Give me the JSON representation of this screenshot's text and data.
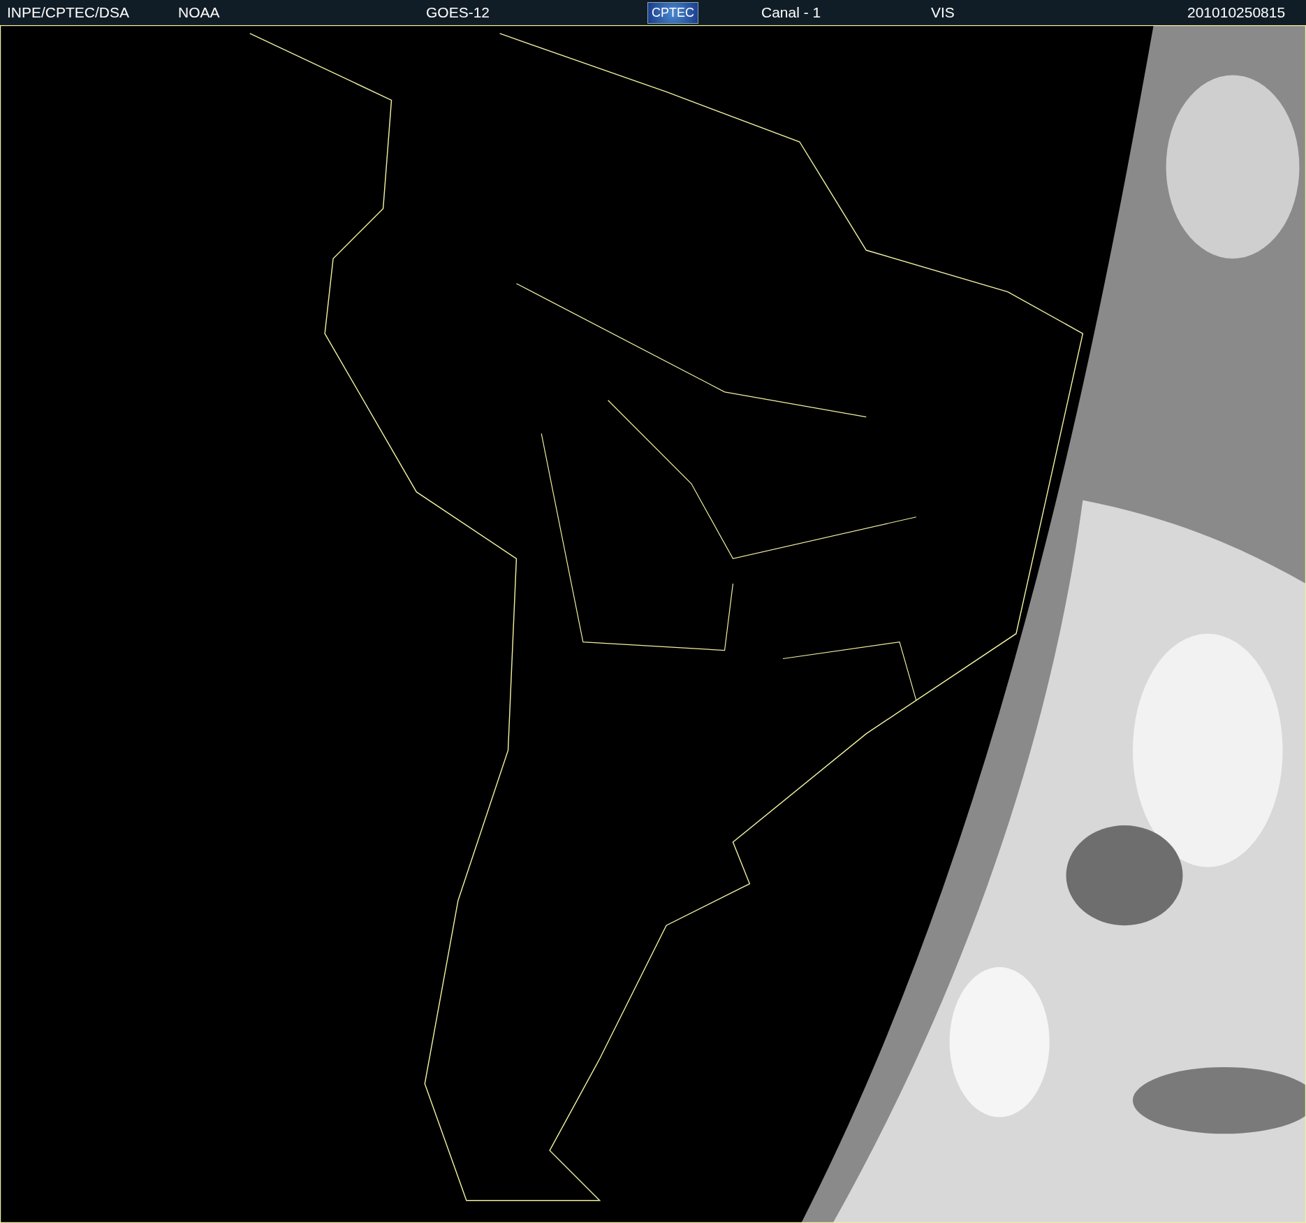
{
  "header": {
    "items": [
      {
        "kind": "text",
        "text": "INPE/CPTEC/DSA"
      },
      {
        "kind": "text",
        "text": "NOAA"
      },
      {
        "kind": "text",
        "text": "GOES-12"
      },
      {
        "kind": "logo",
        "text": "CPTEC"
      },
      {
        "kind": "text",
        "text": "Canal - 1"
      },
      {
        "kind": "text",
        "text": "VIS"
      },
      {
        "kind": "text",
        "text": "201010250815"
      }
    ]
  }
}
